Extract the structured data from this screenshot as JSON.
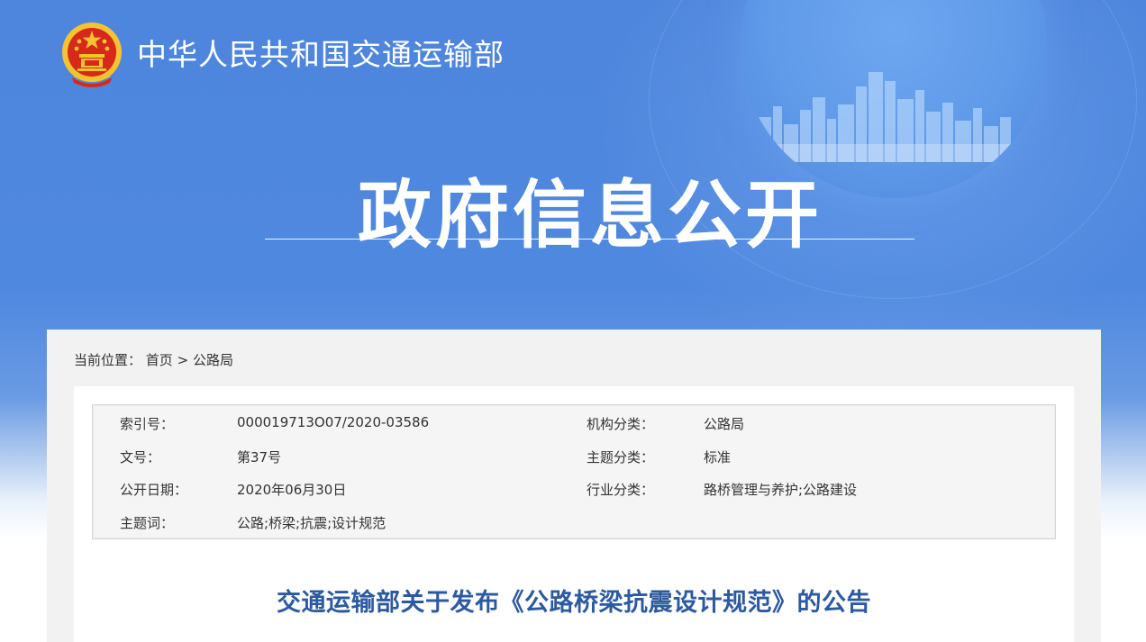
{
  "header": {
    "site_title": "中华人民共和国交通运输部",
    "page_heading": "政府信息公开"
  },
  "breadcrumb": {
    "prefix": "当前位置：",
    "home": "首页",
    "separator": ">",
    "current": "公路局"
  },
  "meta": {
    "rows": [
      {
        "label1": "索引号：",
        "value1": "000019713O07/2020-03586",
        "label2": "机构分类：",
        "value2": "公路局"
      },
      {
        "label1": "文号：",
        "value1": "第37号",
        "label2": "主题分类：",
        "value2": "标准"
      },
      {
        "label1": "公开日期：",
        "value1": "2020年06月30日",
        "label2": "行业分类：",
        "value2": "路桥管理与养护;公路建设"
      },
      {
        "label1": "主题词：",
        "value1": "公路;桥梁;抗震;设计规范",
        "label2": "",
        "value2": ""
      }
    ]
  },
  "document": {
    "title": "交通运输部关于发布《公路桥梁抗震设计规范》的公告"
  },
  "colors": {
    "banner_blue": "#4f88df",
    "title_blue": "#2c5aa0",
    "emblem_red": "#d7281c",
    "emblem_gold": "#f4c430"
  }
}
